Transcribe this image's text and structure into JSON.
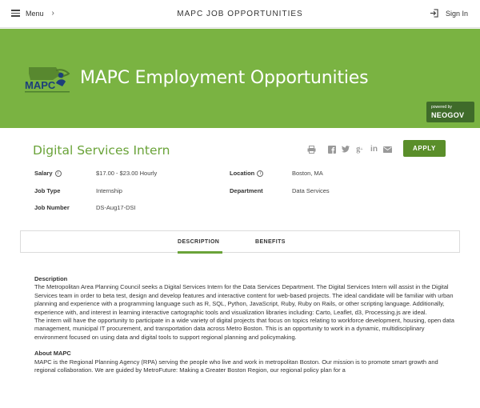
{
  "nav": {
    "menu_label": "Menu",
    "site_title": "MAPC JOB OPPORTUNITIES",
    "signin_label": "Sign In"
  },
  "banner": {
    "logo_text": "MAPC",
    "title": "MAPC Employment Opportunities",
    "powered_by": "powered by",
    "neogov": "NEOGOV"
  },
  "job": {
    "title": "Digital Services Intern",
    "apply_label": "APPLY",
    "fields": {
      "salary_label": "Salary",
      "salary_value": "$17.00 - $23.00 Hourly",
      "type_label": "Job Type",
      "type_value": "Internship",
      "number_label": "Job Number",
      "number_value": "DS-Aug17-DSI",
      "location_label": "Location",
      "location_value": "Boston, MA",
      "department_label": "Department",
      "department_value": "Data Services"
    }
  },
  "tabs": {
    "description": "DESCRIPTION",
    "benefits": "BENEFITS"
  },
  "description": {
    "heading": "Description",
    "para1": "The Metropolitan Area Planning Council seeks a Digital Services Intern for the Data Services Department. The Digital Services Intern will assist in the Digital Services team in order to beta test, design and develop features and interactive content for web-based projects. The ideal candidate will be familiar with urban planning and experience with a programming language such as R, SQL, Python, JavaScript, Ruby, Ruby on Rails, or other scripting language. Additionally, experience with, and interest in learning interactive cartographic tools and visualization libraries including: Carto, Leaflet, d3, Processing.js are ideal.",
    "para2": " The intern will have the opportunity to participate in a wide variety of digital projects that focus on topics relating to workforce development, housing, open data management, municipal IT procurement, and transportation data across Metro Boston. This is an opportunity to work in a dynamic, multidisciplinary environment focused on using data and digital tools to support regional planning and policymaking.",
    "about_heading": "About MAPC",
    "about_para": "MAPC is the Regional Planning Agency (RPA) serving the people who live and work in metropolitan Boston. Our mission is to promote smart growth and regional collaboration. We are guided by MetroFuture: Making a Greater Boston Region, our regional policy plan for a"
  },
  "colors": {
    "banner_green": "#7ab342",
    "title_green": "#6aa339",
    "apply_green": "#5a8e2a",
    "neogov_green": "#3f6b2a"
  },
  "icons": {
    "menu": "hamburger-icon",
    "signin": "sign-in-icon",
    "print": "print-icon",
    "facebook": "facebook-icon",
    "twitter": "twitter-icon",
    "googleplus": "google-plus-icon",
    "linkedin": "linkedin-icon",
    "email": "email-icon",
    "info": "info-icon"
  }
}
